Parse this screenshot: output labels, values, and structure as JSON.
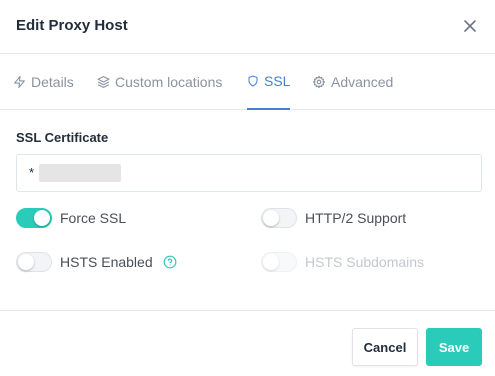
{
  "modal": {
    "title": "Edit Proxy Host"
  },
  "tabs": [
    {
      "label": "Details",
      "icon": "zap-icon",
      "active": false
    },
    {
      "label": "Custom locations",
      "icon": "layers-icon",
      "active": false
    },
    {
      "label": "SSL",
      "icon": "shield-icon",
      "active": true
    },
    {
      "label": "Advanced",
      "icon": "gear-icon",
      "active": false
    }
  ],
  "ssl": {
    "certificate_label": "SSL Certificate",
    "certificate_value": "*"
  },
  "toggles": {
    "force_ssl": {
      "label": "Force SSL",
      "on": true,
      "disabled": false
    },
    "http2": {
      "label": "HTTP/2 Support",
      "on": false,
      "disabled": false
    },
    "hsts_enabled": {
      "label": "HSTS Enabled",
      "on": false,
      "disabled": false
    },
    "hsts_subdomains": {
      "label": "HSTS Subdomains",
      "on": false,
      "disabled": true
    }
  },
  "footer": {
    "cancel_label": "Cancel",
    "save_label": "Save"
  },
  "colors": {
    "accent_teal": "#2bcbba",
    "active_tab_blue": "#467fcf",
    "muted_text": "#8a939f"
  }
}
